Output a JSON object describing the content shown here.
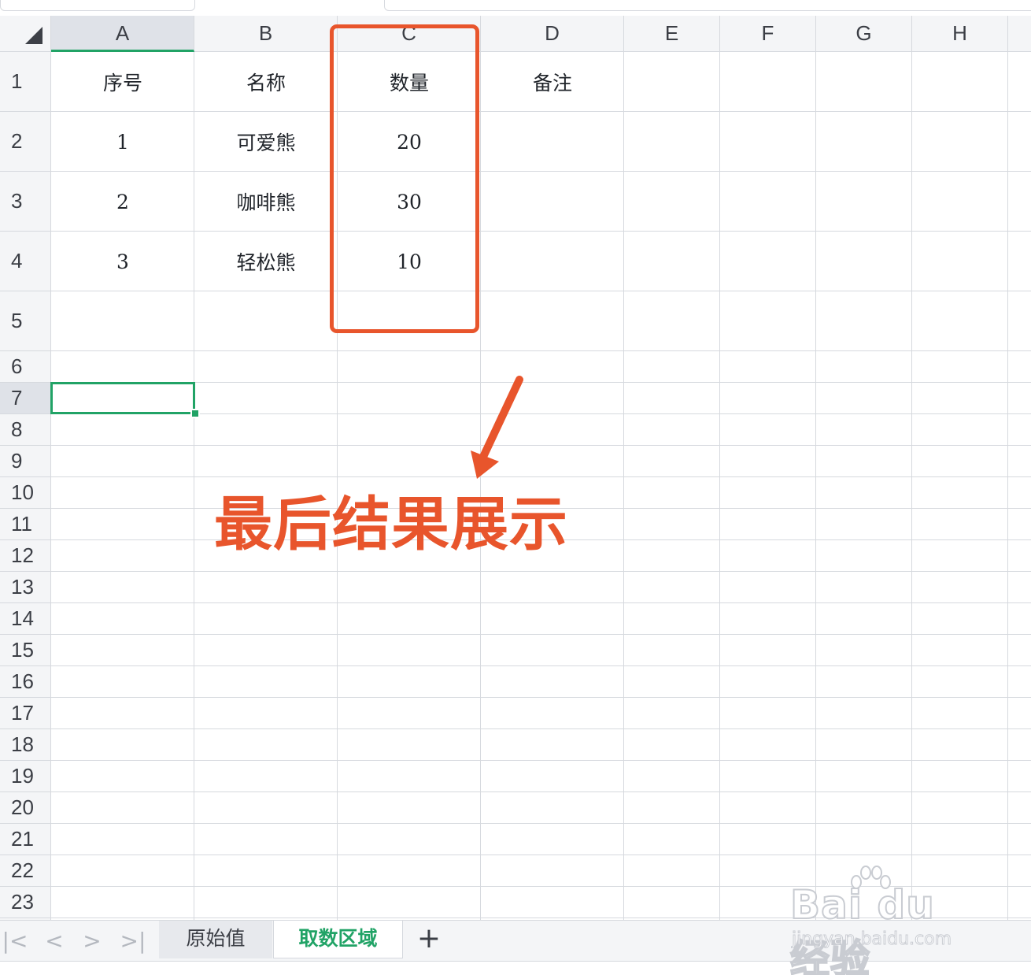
{
  "columns": [
    "A",
    "B",
    "C",
    "D",
    "E",
    "F",
    "G",
    "H"
  ],
  "selected_column": "A",
  "row_labels": [
    "1",
    "2",
    "3",
    "4",
    "5",
    "6",
    "7",
    "8",
    "9",
    "10",
    "11",
    "12",
    "13",
    "14",
    "15",
    "16",
    "17",
    "18",
    "19",
    "20",
    "21",
    "22",
    "23"
  ],
  "selected_row": "7",
  "table": {
    "headers": [
      "序号",
      "名称",
      "数量",
      "备注"
    ],
    "rows": [
      [
        "1",
        "可爱熊",
        "20",
        ""
      ],
      [
        "2",
        "咖啡熊",
        "30",
        ""
      ],
      [
        "3",
        "轻松熊",
        "10",
        ""
      ]
    ]
  },
  "selected_cell": "A7",
  "annotation": {
    "text": "最后结果展示",
    "color": "#e8552c"
  },
  "sheet_tabs": [
    {
      "label": "原始值",
      "active": false
    },
    {
      "label": "取数区域",
      "active": true
    }
  ],
  "sheet_nav_icons": [
    "first-sheet-icon",
    "prev-sheet-icon",
    "next-sheet-icon",
    "last-sheet-icon"
  ],
  "add_sheet_symbol": "+",
  "accent_color": "#21a366",
  "watermark": {
    "logo": "Bai du 经验",
    "url": "jingyan.baidu.com"
  }
}
